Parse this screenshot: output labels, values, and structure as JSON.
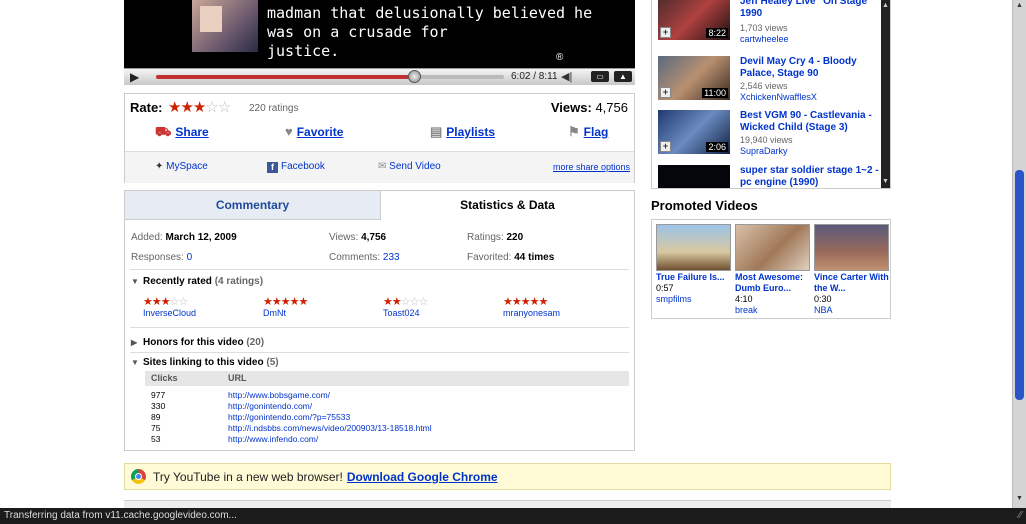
{
  "player": {
    "subtitle": "madman that delusionally believed he\nwas on a crusade for\njustice.",
    "time": "6:02 / 8:11",
    "progress": 0.74
  },
  "rating": {
    "label": "Rate:",
    "stars": 3,
    "count_text": "220 ratings",
    "views_label": "Views:",
    "views_value": "4,756"
  },
  "share": {
    "items": [
      {
        "label": "Share",
        "icon": "share-icon"
      },
      {
        "label": "Favorite",
        "icon": "heart-icon"
      },
      {
        "label": "Playlists",
        "icon": "playlist-icon"
      },
      {
        "label": "Flag",
        "icon": "flag-icon"
      }
    ],
    "sub": {
      "myspace": "MySpace",
      "facebook": "Facebook",
      "send": "Send Video",
      "more": "more share options"
    }
  },
  "stats": {
    "tabs": [
      "Commentary",
      "Statistics & Data"
    ],
    "added_label": "Added:",
    "added_value": "March 12, 2009",
    "views_label": "Views:",
    "views_value": "4,756",
    "ratings_label": "Ratings:",
    "ratings_value": "220",
    "responses_label": "Responses:",
    "responses_value": "0",
    "comments_label": "Comments:",
    "comments_value": "233",
    "favorited_label": "Favorited:",
    "favorited_value": "44 times",
    "recently_rated": {
      "title": "Recently rated",
      "count": "(4 ratings)"
    },
    "raters": [
      {
        "user": "InverseCloud",
        "stars": 3
      },
      {
        "user": "DmNt",
        "stars": 5
      },
      {
        "user": "Toast024",
        "stars": 2
      },
      {
        "user": "mranyonesam",
        "stars": 5
      }
    ],
    "honors": {
      "title": "Honors for this video",
      "count": "(20)"
    },
    "sites": {
      "title": "Sites linking to this video",
      "count": "(5)"
    },
    "links_header": {
      "clicks": "Clicks",
      "url": "URL"
    },
    "links": [
      {
        "clicks": "977",
        "url": "http://www.bobsgame.com/"
      },
      {
        "clicks": "330",
        "url": "http://gonintendo.com/"
      },
      {
        "clicks": "89",
        "url": "http://gonintendo.com/?p=75533"
      },
      {
        "clicks": "75",
        "url": "http://i.ndsbbs.com/news/video/200903/13-18518.html"
      },
      {
        "clicks": "53",
        "url": "http://www.infendo.com/"
      }
    ]
  },
  "chrome_banner": {
    "text": "Try YouTube in a new web browser!",
    "link": "Download Google Chrome"
  },
  "related": [
    {
      "title": "Jeff Healey Live \"On Stage\" 1990",
      "views": "1,703 views",
      "user": "cartwheelee",
      "duration": "8:22"
    },
    {
      "title": "Devil May Cry 4 - Bloody Palace, Stage 90",
      "views": "2,546 views",
      "user": "XchickenNwafflesX",
      "duration": "11:00"
    },
    {
      "title": "Best VGM 90 - Castlevania - Wicked Child (Stage 3)",
      "views": "19,940 views",
      "user": "SupraDarky",
      "duration": "2:06"
    },
    {
      "title": "super star soldier stage 1~2 - pc engine (1990)",
      "views": "",
      "user": "",
      "duration": ""
    }
  ],
  "promoted": {
    "title": "Promoted Videos",
    "items": [
      {
        "title": "True Failure Is...",
        "duration": "0:57",
        "by": "smpfilms"
      },
      {
        "title": "Most Awesome: Dumb Euro...",
        "duration": "4:10",
        "by": "break"
      },
      {
        "title": "Vince Carter With the W...",
        "duration": "0:30",
        "by": "NBA"
      }
    ]
  },
  "status_text": "Transferring data from v11.cache.googlevideo.com..."
}
